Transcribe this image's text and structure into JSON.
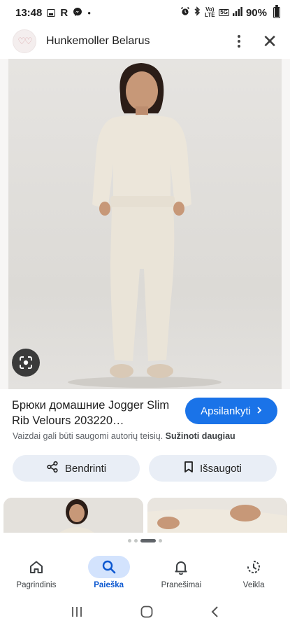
{
  "status_bar": {
    "time": "13:48",
    "letter_indicator": "R",
    "network_type": "Vo) LTE",
    "network_badge": "5G",
    "battery": "90%",
    "battery_level": 0.9
  },
  "header": {
    "site_name": "Hunkemoller Belarus",
    "logo_icon": "hunkemoller-logo-icon",
    "menu_icon": "more-vert-icon",
    "close_icon": "close-icon"
  },
  "result": {
    "title": "Брюки домашние Jogger Slim Rib Velours 203220…",
    "visit_label": "Apsilankyti",
    "copyright_text": "Vaizdai gali būti saugomi autorių teisių.",
    "learn_more_label": "Sužinoti daugiau"
  },
  "actions": {
    "share_label": "Bendrinti",
    "save_label": "Išsaugoti"
  },
  "pager": {
    "count": 4,
    "active_index": 2
  },
  "bottom_nav": {
    "items": [
      {
        "label": "Pagrindinis",
        "icon": "home-icon"
      },
      {
        "label": "Paieška",
        "icon": "search-icon"
      },
      {
        "label": "Pranešimai",
        "icon": "bell-icon"
      },
      {
        "label": "Veikla",
        "icon": "activity-icon"
      }
    ],
    "active_index": 1
  },
  "colors": {
    "accent": "#1a73e8",
    "pill_bg": "#e9eef6",
    "nav_active_bg": "#d3e3fd",
    "nav_active_text": "#0b57d0"
  }
}
